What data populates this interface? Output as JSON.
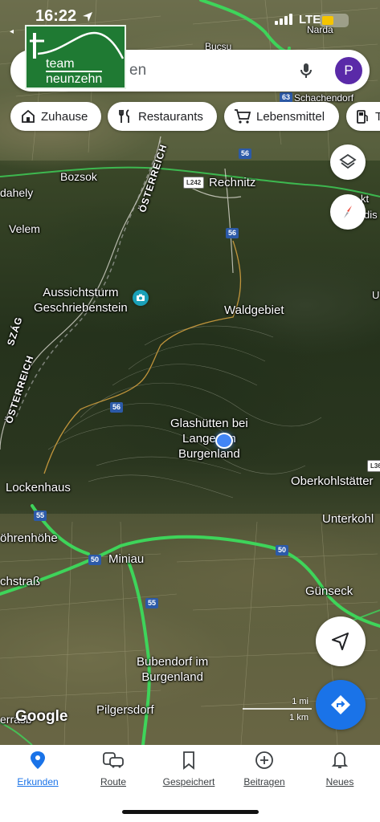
{
  "status_bar": {
    "time": "16:22",
    "back_label": "◂",
    "network": "LTE"
  },
  "search": {
    "placeholder": "en",
    "avatar_letter": "P"
  },
  "logo": {
    "line1": "team",
    "line2": "neunzehn"
  },
  "chips": [
    {
      "label": "Zuhause",
      "icon": "home-icon"
    },
    {
      "label": "Restaurants",
      "icon": "restaurant-icon"
    },
    {
      "label": "Lebensmittel",
      "icon": "cart-icon"
    },
    {
      "label": "T",
      "icon": "gas-station-icon"
    }
  ],
  "map": {
    "places": {
      "narda": "Narda",
      "bucsu": "Bucsu",
      "schachendorf": "Schachendorf",
      "bozsok": "Bozsok",
      "rechnitz": "Rechnitz",
      "dahely": "dahely",
      "velem": "Velem",
      "aussichtsturm": "Aussichtsturm\nGeschriebenstein",
      "waldgebiet": "Waldgebiet",
      "glashuetten": "Glashütten bei\nLanger im\nBurgenland",
      "lockenhaus": "Lockenhaus",
      "oberkohlstaetten": "Oberkohlstätter",
      "unterkohl": "Unterkohl",
      "ohrenhoehe": "öhrenhöhe",
      "miniau": "Miniau",
      "chstrass": "chstraß",
      "guenseck": "Günseck",
      "bubendorf": "Bubendorf im\nBurgenland",
      "pilgersdorf": "Pilgersdorf",
      "erras": "errasb",
      "kt": "kt",
      "dis": "dis",
      "u": "U"
    },
    "borders": {
      "oesterreich_top": "ÖSTERREICH",
      "oesterreich_left": "ÖSTERREICH",
      "szag": "SZÁG"
    },
    "road_shields": {
      "r63": "63",
      "r56a": "56",
      "l242": "L242",
      "r56b": "56",
      "r56c": "56",
      "l36": "L36",
      "r55a": "55",
      "r50a": "50",
      "r50b": "50",
      "r55b": "55"
    }
  },
  "scale": {
    "mi": "1 mi",
    "km": "1 km"
  },
  "attribution": "Google",
  "nav": [
    {
      "label": "Erkunden",
      "icon": "pin-icon",
      "active": true
    },
    {
      "label": "Route",
      "icon": "commute-icon",
      "active": false
    },
    {
      "label": "Gespeichert",
      "icon": "bookmark-icon",
      "active": false
    },
    {
      "label": "Beitragen",
      "icon": "add-circle-icon",
      "active": false
    },
    {
      "label": "Neues",
      "icon": "bell-icon",
      "active": false
    }
  ],
  "colors": {
    "accent": "#1a73e8",
    "avatar": "#5a2aa8",
    "logo_green": "#1f7a33",
    "road_green": "#3ed45a",
    "location_blue": "#4285f4"
  }
}
